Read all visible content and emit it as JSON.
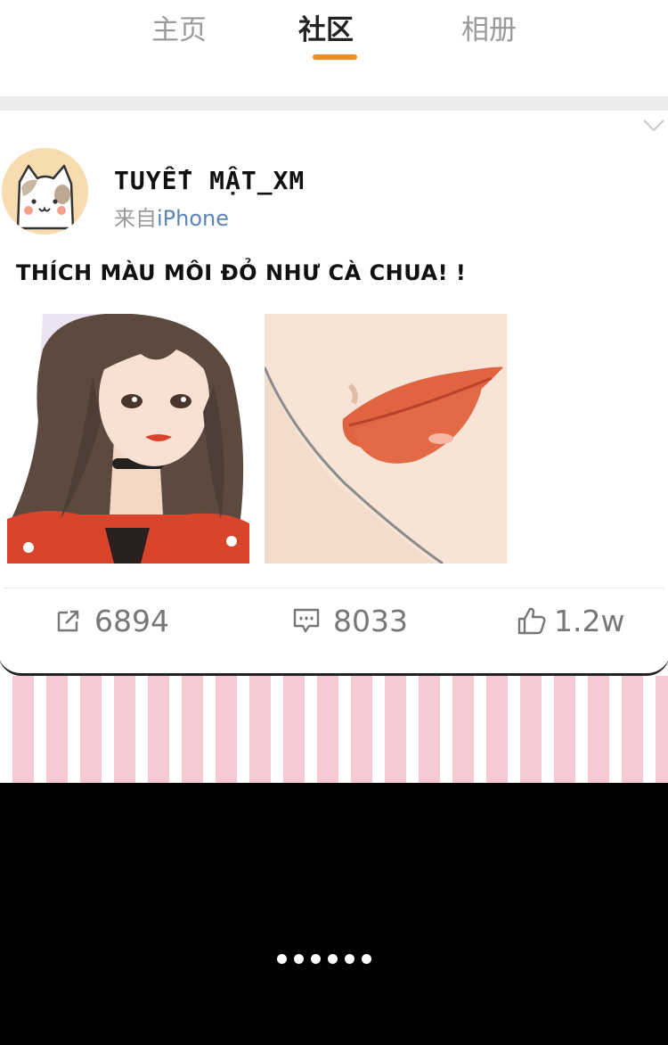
{
  "tabs": [
    {
      "label": "主页"
    },
    {
      "label": "社区"
    },
    {
      "label": "相册"
    }
  ],
  "accent_color": "#f08a24",
  "post": {
    "username": "TUYẾT MẬT_XM",
    "source_prefix": "来自",
    "source_device": "iPhone",
    "text": "THÍCH MÀU MÔI ĐỎ NHƯ CÀ CHUA!   !",
    "images": [
      {
        "icon": "girl-portrait-illustration"
      },
      {
        "icon": "red-lips-closeup-illustration"
      }
    ],
    "actions": {
      "share_count": "6894",
      "comment_count": "8033",
      "like_count": "1.2w"
    }
  },
  "pager": {
    "dot_count": 6
  }
}
